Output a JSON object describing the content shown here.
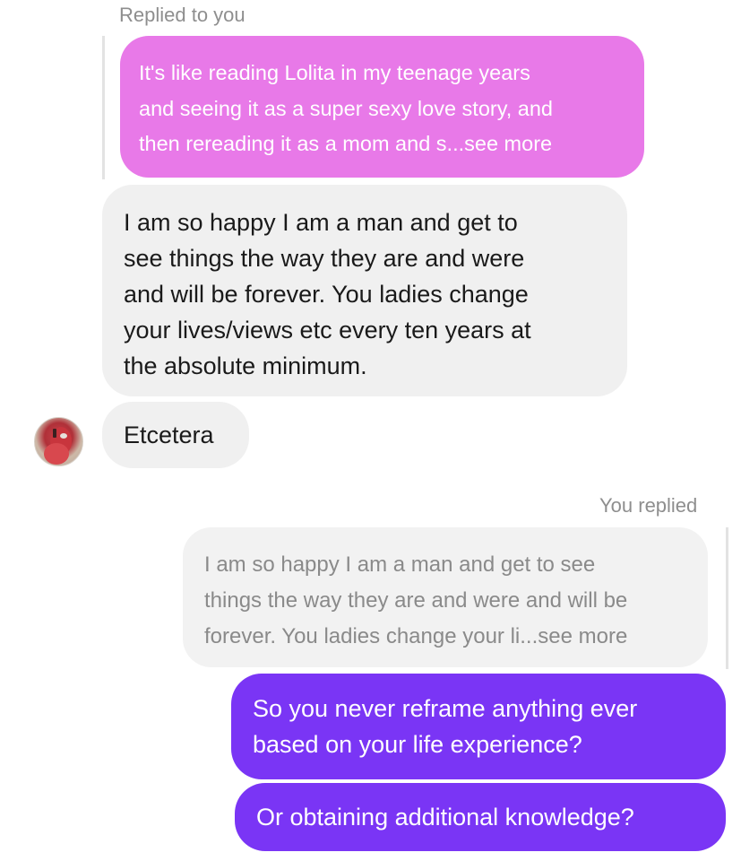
{
  "thread": {
    "incoming_reply_label": "Replied to you",
    "incoming_quoted_lines": [
      "It's like reading Lolita in my teenage years",
      "and seeing it as a super sexy love story, and",
      "then rereading it as a mom and s...see more"
    ],
    "incoming_message_lines": [
      "I am so happy I am a man and get to",
      "see things the way they are and were",
      "and will be forever. You ladies change",
      "your lives/views etc every ten years at",
      "the absolute minimum."
    ],
    "incoming_message_2": "Etcetera",
    "outgoing_reply_label": "You replied",
    "outgoing_quoted_lines": [
      "I am so happy I am a man and get to see",
      "things the way they are and were and will be",
      "forever. You ladies change your li...see more"
    ],
    "outgoing_message_lines": [
      "So you never reframe anything ever",
      "based on your life experience?"
    ],
    "outgoing_message_2": "Or obtaining additional knowledge?"
  },
  "colors": {
    "incoming_quote_bubble": "#e879e8",
    "incoming_bubble": "#f0f0f0",
    "outgoing_quote_bubble": "#f2f2f2",
    "outgoing_bubble": "#7a35f5",
    "meta_text": "#8e8e8e"
  },
  "icons": {
    "sender_avatar": "avatar"
  }
}
